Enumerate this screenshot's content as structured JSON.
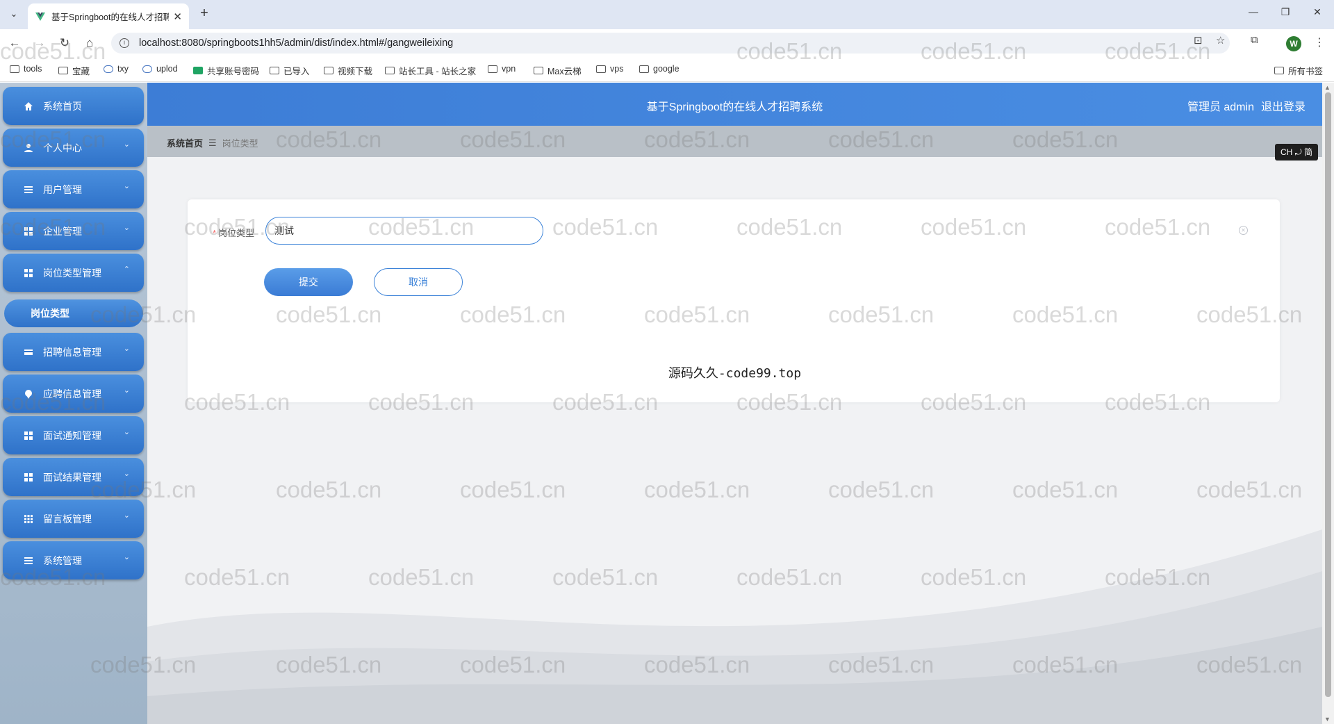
{
  "browser": {
    "tab_title": "基于Springboot的在线人才招聘",
    "url": "localhost:8080/springboots1hh5/admin/dist/index.html#/gangweileixing",
    "profile_initial": "W",
    "bookmarks": [
      "tools",
      "宝藏",
      "txy",
      "uplod",
      "共享账号密码",
      "已导入",
      "视频下载",
      "站长工具 - 站长之家",
      "vpn",
      "Max云梯",
      "vps",
      "google"
    ],
    "all_bookmarks": "所有书签"
  },
  "header": {
    "system_title": "基于Springboot的在线人才招聘系统",
    "admin_label": "管理员 admin",
    "logout_label": "退出登录"
  },
  "sidebar": {
    "items": [
      {
        "label": "系统首页",
        "icon": "home-icon"
      },
      {
        "label": "个人中心",
        "icon": "user-icon"
      },
      {
        "label": "用户管理",
        "icon": "list-icon"
      },
      {
        "label": "企业管理",
        "icon": "grid-icon"
      },
      {
        "label": "岗位类型管理",
        "icon": "grid-icon"
      },
      {
        "label": "招聘信息管理",
        "icon": "card-icon"
      },
      {
        "label": "应聘信息管理",
        "icon": "pin-icon"
      },
      {
        "label": "面试通知管理",
        "icon": "grid-icon"
      },
      {
        "label": "面试结果管理",
        "icon": "grid-icon"
      },
      {
        "label": "留言板管理",
        "icon": "table-icon"
      },
      {
        "label": "系统管理",
        "icon": "list-icon"
      }
    ],
    "active_sub": "岗位类型"
  },
  "breadcrumb": {
    "home": "系统首页",
    "current": "岗位类型"
  },
  "ime": "CH ⤾ 简",
  "form": {
    "label": "岗位类型",
    "value": "测试",
    "submit_label": "提交",
    "cancel_label": "取消"
  },
  "caption": "源码久久-code99.top",
  "watermark": "code51.cn",
  "colors": {
    "primary": "#3b82d8",
    "topbar": "#3d7dd6",
    "sidebar_bg": "#b9c8d8",
    "required": "#f56c6c"
  }
}
